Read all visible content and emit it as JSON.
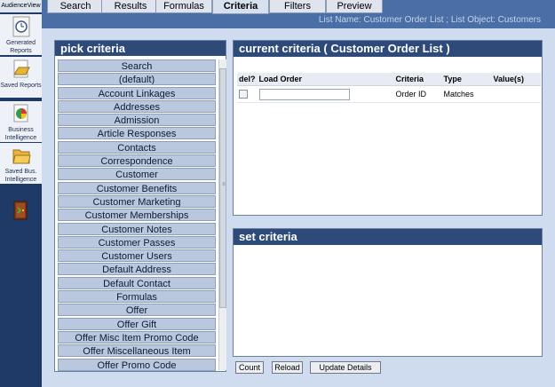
{
  "app": {
    "name": "AudienceView"
  },
  "sidebar": {
    "items": [
      {
        "label": "Generated Reports",
        "icon": "clock-icon"
      },
      {
        "label": "Saved Reports",
        "icon": "folder-icon"
      },
      {
        "label": "Business Intelligence",
        "icon": "pie-chart-icon"
      },
      {
        "label": "Saved Bus. Intelligence",
        "icon": "folder-icon"
      },
      {
        "label": "",
        "icon": "exit-door-icon"
      }
    ]
  },
  "tabs": [
    {
      "label": "Search"
    },
    {
      "label": "Results"
    },
    {
      "label": "Formulas"
    },
    {
      "label": "Criteria",
      "active": true
    },
    {
      "label": "Filters"
    },
    {
      "label": "Preview"
    }
  ],
  "list_info": "List Name: Customer Order List ; List Object: Customers",
  "pick_criteria": {
    "title": "pick criteria",
    "items": [
      "Search",
      "(default)",
      "Account Linkages",
      "Addresses",
      "Admission",
      "Article Responses",
      "Contacts",
      "Correspondence",
      "Customer",
      "Customer Benefits",
      "Customer Marketing",
      "Customer Memberships",
      "Customer Notes",
      "Customer Passes",
      "Customer Users",
      "Default Address",
      "Default Contact",
      "Formulas",
      "Offer",
      "Offer Gift",
      "Offer Misc Item Promo Code",
      "Offer Miscellaneous Item",
      "Offer Promo Code"
    ]
  },
  "current_criteria": {
    "title": "current criteria ( Customer Order List )",
    "columns": [
      "del?",
      "Load Order",
      "Criteria",
      "Type",
      "Value(s)"
    ],
    "rows": [
      {
        "load_order": "",
        "criteria": "Order ID",
        "type": "Matches",
        "values": ""
      }
    ]
  },
  "set_criteria": {
    "title": "set criteria"
  },
  "buttons": {
    "count": "Count",
    "reload": "Reload",
    "update": "Update Details"
  }
}
